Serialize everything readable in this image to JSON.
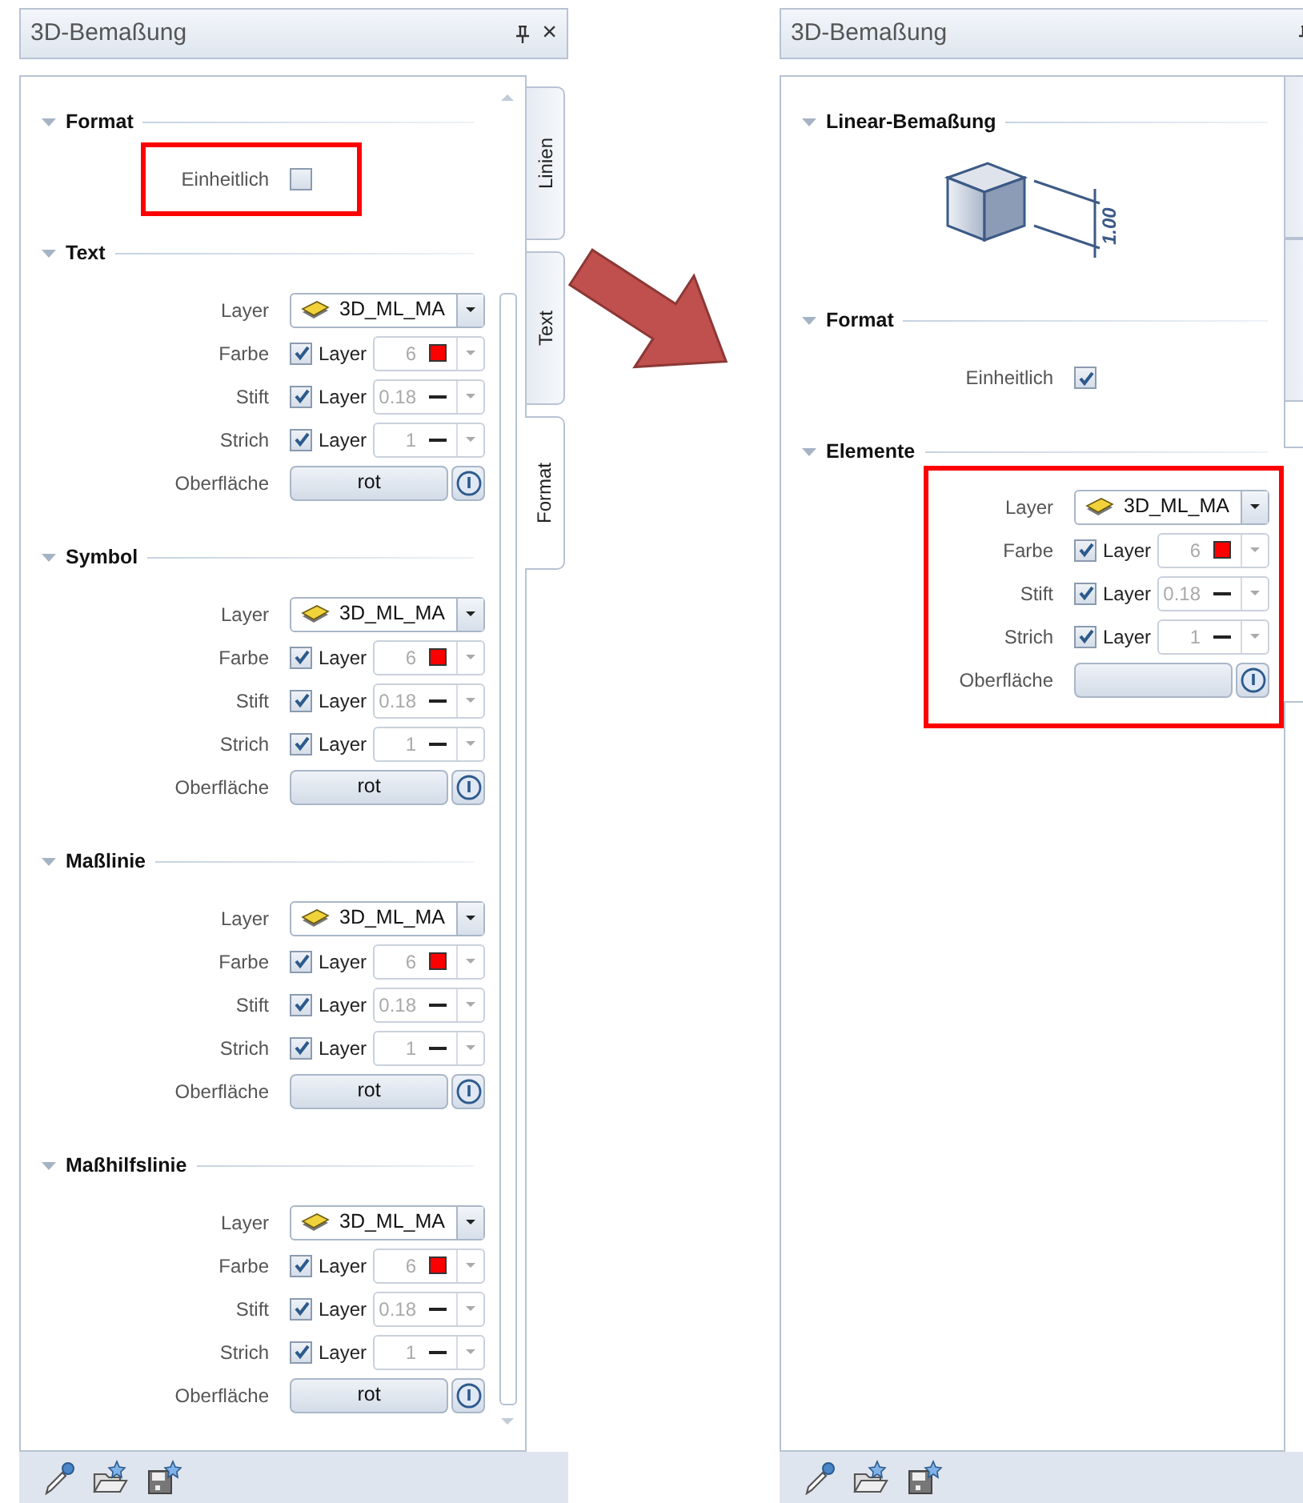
{
  "panels": [
    {
      "title": "3D-Bemaßung",
      "close": "×",
      "tabs": [
        {
          "label": "Linien",
          "selected": false
        },
        {
          "label": "Text",
          "selected": false
        },
        {
          "label": "Format",
          "selected": true
        }
      ],
      "sections": [
        {
          "title": "Format",
          "kind": "toggle",
          "expanded": true,
          "highlighted": true,
          "label": "Einheitlich",
          "checked": false
        },
        {
          "title": "Text",
          "kind": "properties",
          "expanded": true,
          "highlighted": false,
          "rows": [
            {
              "kind": "layer",
              "label": "Layer",
              "value": "3D_ML_MA"
            },
            {
              "kind": "color",
              "label": "Farbe",
              "checked": true,
              "check_label": "Layer",
              "value": "6",
              "color": "#ff0000"
            },
            {
              "kind": "pen",
              "label": "Stift",
              "checked": true,
              "check_label": "Layer",
              "value": "0.18"
            },
            {
              "kind": "line",
              "label": "Strich",
              "checked": true,
              "check_label": "Layer",
              "value": "1"
            },
            {
              "kind": "surface",
              "label": "Oberfläche",
              "value": "rot"
            }
          ]
        },
        {
          "title": "Symbol",
          "kind": "properties",
          "expanded": true,
          "highlighted": false,
          "rows": [
            {
              "kind": "layer",
              "label": "Layer",
              "value": "3D_ML_MA"
            },
            {
              "kind": "color",
              "label": "Farbe",
              "checked": true,
              "check_label": "Layer",
              "value": "6",
              "color": "#ff0000"
            },
            {
              "kind": "pen",
              "label": "Stift",
              "checked": true,
              "check_label": "Layer",
              "value": "0.18"
            },
            {
              "kind": "line",
              "label": "Strich",
              "checked": true,
              "check_label": "Layer",
              "value": "1"
            },
            {
              "kind": "surface",
              "label": "Oberfläche",
              "value": "rot"
            }
          ]
        },
        {
          "title": "Maßlinie",
          "kind": "properties",
          "expanded": true,
          "highlighted": false,
          "rows": [
            {
              "kind": "layer",
              "label": "Layer",
              "value": "3D_ML_MA"
            },
            {
              "kind": "color",
              "label": "Farbe",
              "checked": true,
              "check_label": "Layer",
              "value": "6",
              "color": "#ff0000"
            },
            {
              "kind": "pen",
              "label": "Stift",
              "checked": true,
              "check_label": "Layer",
              "value": "0.18"
            },
            {
              "kind": "line",
              "label": "Strich",
              "checked": true,
              "check_label": "Layer",
              "value": "1"
            },
            {
              "kind": "surface",
              "label": "Oberfläche",
              "value": "rot"
            }
          ]
        },
        {
          "title": "Maßhilfslinie",
          "kind": "properties",
          "expanded": true,
          "highlighted": false,
          "rows": [
            {
              "kind": "layer",
              "label": "Layer",
              "value": "3D_ML_MA"
            },
            {
              "kind": "color",
              "label": "Farbe",
              "checked": true,
              "check_label": "Layer",
              "value": "6",
              "color": "#ff0000"
            },
            {
              "kind": "pen",
              "label": "Stift",
              "checked": true,
              "check_label": "Layer",
              "value": "0.18"
            },
            {
              "kind": "line",
              "label": "Strich",
              "checked": true,
              "check_label": "Layer",
              "value": "1"
            },
            {
              "kind": "surface",
              "label": "Oberfläche",
              "value": "rot"
            }
          ]
        }
      ]
    },
    {
      "title": "3D-Bemaßung",
      "tabs": [
        {
          "selected": false
        },
        {
          "selected": false
        },
        {
          "selected": true
        }
      ],
      "sections": [
        {
          "title": "Linear-Bemaßung",
          "kind": "figure",
          "expanded": true,
          "highlighted": false,
          "dimension": "1.00"
        },
        {
          "title": "Format",
          "kind": "toggle",
          "expanded": true,
          "highlighted": false,
          "label": "Einheitlich",
          "checked": true
        },
        {
          "title": "Elemente",
          "kind": "properties",
          "expanded": true,
          "highlighted": true,
          "rows": [
            {
              "kind": "layer",
              "label": "Layer",
              "value": "3D_ML_MA"
            },
            {
              "kind": "color",
              "label": "Farbe",
              "checked": true,
              "check_label": "Layer",
              "value": "6",
              "color": "#ff0000"
            },
            {
              "kind": "pen",
              "label": "Stift",
              "checked": true,
              "check_label": "Layer",
              "value": "0.18"
            },
            {
              "kind": "line",
              "label": "Strich",
              "checked": true,
              "check_label": "Layer",
              "value": "1"
            },
            {
              "kind": "surface",
              "label": "Oberfläche"
            }
          ]
        }
      ]
    }
  ]
}
